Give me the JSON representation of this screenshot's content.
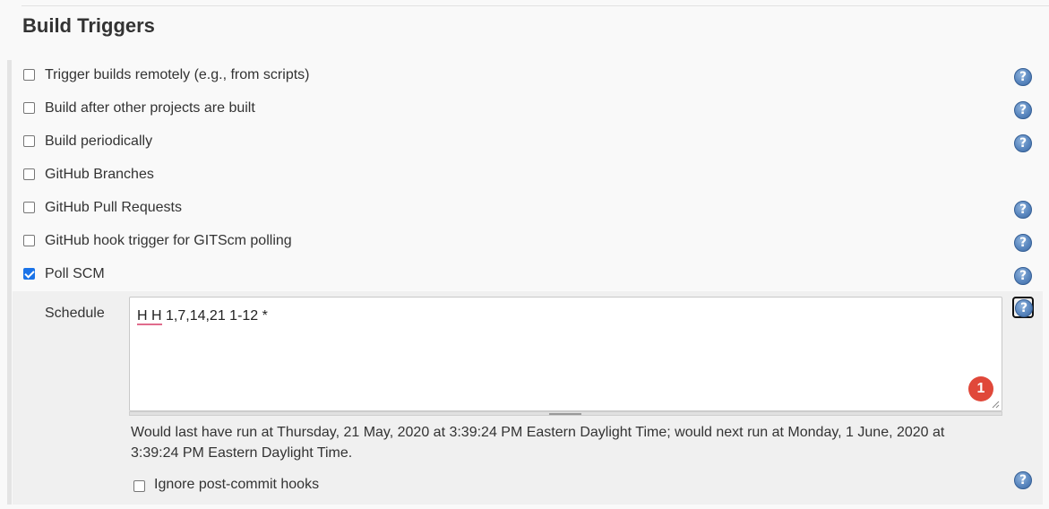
{
  "section": {
    "title": "Build Triggers"
  },
  "triggers": [
    {
      "label": "Trigger builds remotely (e.g., from scripts)",
      "checked": false,
      "has_help": true
    },
    {
      "label": "Build after other projects are built",
      "checked": false,
      "has_help": true
    },
    {
      "label": "Build periodically",
      "checked": false,
      "has_help": true
    },
    {
      "label": "GitHub Branches",
      "checked": false,
      "has_help": false
    },
    {
      "label": "GitHub Pull Requests",
      "checked": false,
      "has_help": true
    },
    {
      "label": "GitHub hook trigger for GITScm polling",
      "checked": false,
      "has_help": true
    },
    {
      "label": "Poll SCM",
      "checked": true,
      "has_help": true
    }
  ],
  "poll_scm": {
    "schedule_label": "Schedule",
    "schedule_value": "H H 1,7,14,21 1-12 *",
    "badge_count": "1",
    "run_info": "Would last have run at Thursday, 21 May, 2020 at 3:39:24 PM Eastern Daylight Time; would next run at Monday, 1 June, 2020 at 3:39:24 PM Eastern Daylight Time.",
    "ignore_hooks_label": "Ignore post-commit hooks",
    "ignore_hooks_checked": false
  },
  "icons": {
    "help": "help-icon",
    "help_glyph": "?"
  },
  "colors": {
    "checkbox_checked": "#1a73e8",
    "help_icon": "#5a87bf",
    "badge": "#e0483a"
  }
}
